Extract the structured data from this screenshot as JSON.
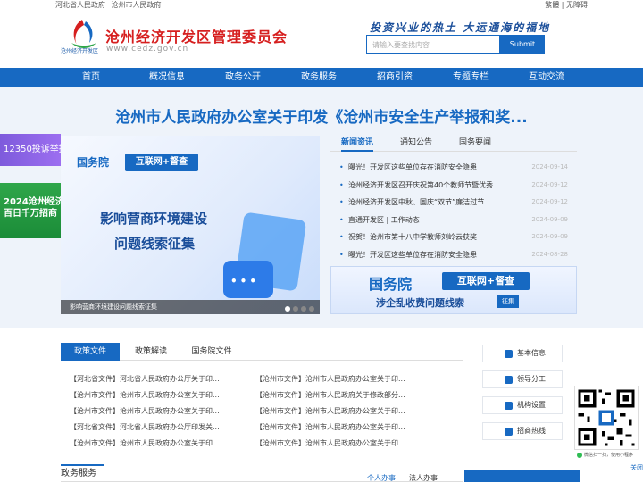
{
  "topbar": {
    "links": [
      "河北省人民政府",
      "沧州市人民政府"
    ],
    "right": "繁體 | 无障碍"
  },
  "header": {
    "site_name": "沧州经济开发区管理委员会",
    "url": "www.cedz.gov.cn",
    "logo_sub": "沧州经济开发区",
    "slogan": "投资兴业的热土  大运通海的福地",
    "search_placeholder": "请输入要查找内容",
    "search_button": "Submit"
  },
  "nav": [
    "首页",
    "概况信息",
    "政务公开",
    "政务服务",
    "招商引资",
    "专题专栏",
    "互动交流"
  ],
  "headline": "沧州市人民政府办公室关于印发《沧州市安全生产举报和奖...",
  "floaters": {
    "hotline": "12350投诉举报",
    "promo_line1": "2024沧州经济",
    "promo_line2": "百日千万招商"
  },
  "slider": {
    "badge_left": "国务院",
    "badge_right": "互联网+督查",
    "title_line1": "影响营商环境建设",
    "title_line2": "问题线索征集",
    "bubble_text": "•••",
    "caption": "影响营商环境建设问题线索征集"
  },
  "news": {
    "tabs": [
      "新闻资讯",
      "通知公告",
      "国务要闻"
    ],
    "items": [
      {
        "title": "曝光！开发区这些单位存在消防安全隐患",
        "date": "2024-09-14"
      },
      {
        "title": "沧州经济开发区召开庆祝第40个教师节暨优秀...",
        "date": "2024-09-12"
      },
      {
        "title": "沧州经济开发区中秋、国庆“双节”廉洁过节...",
        "date": "2024-09-12"
      },
      {
        "title": "直通开发区 | 工作动态",
        "date": "2024-09-09"
      },
      {
        "title": "祝贺！沧州市第十八中学教师刘岭云获奖",
        "date": "2024-09-09"
      },
      {
        "title": "曝光！开发区这些单位存在消防安全隐患",
        "date": "2024-08-28"
      }
    ]
  },
  "news_banner": {
    "left": "国务院",
    "right": "互联网+督查",
    "subtitle": "涉企乱收费问题线索",
    "tag": "征集"
  },
  "policy": {
    "tabs": [
      "政策文件",
      "政策解读",
      "国务院文件"
    ],
    "left": [
      "【河北省文件】河北省人民政府办公厅关于印...",
      "【沧州市文件】沧州市人民政府办公室关于印...",
      "【沧州市文件】沧州市人民政府办公室关于印...",
      "【河北省文件】河北省人民政府办公厅印发关...",
      "【沧州市文件】沧州市人民政府办公室关于印..."
    ],
    "right": [
      "【沧州市文件】沧州市人民政府办公室关于印...",
      "【沧州市文件】沧州市人民政府关于修改部分...",
      "【沧州市文件】沧州市人民政府办公室关于印...",
      "【沧州市文件】沧州市人民政府办公室关于印...",
      "【沧州市文件】沧州市人民政府办公室关于印..."
    ]
  },
  "quick_links": [
    "基本信息",
    "领导分工",
    "机构设置",
    "招商热线"
  ],
  "qr": {
    "caption": "微信扫一扫，使用小程序",
    "close": "关闭"
  },
  "gov_service": {
    "title": "政务服务",
    "tab1": "个人办事",
    "tab2": "法人办事"
  },
  "colors": {
    "primary": "#1769c2",
    "brand_red": "#d61f1f"
  }
}
